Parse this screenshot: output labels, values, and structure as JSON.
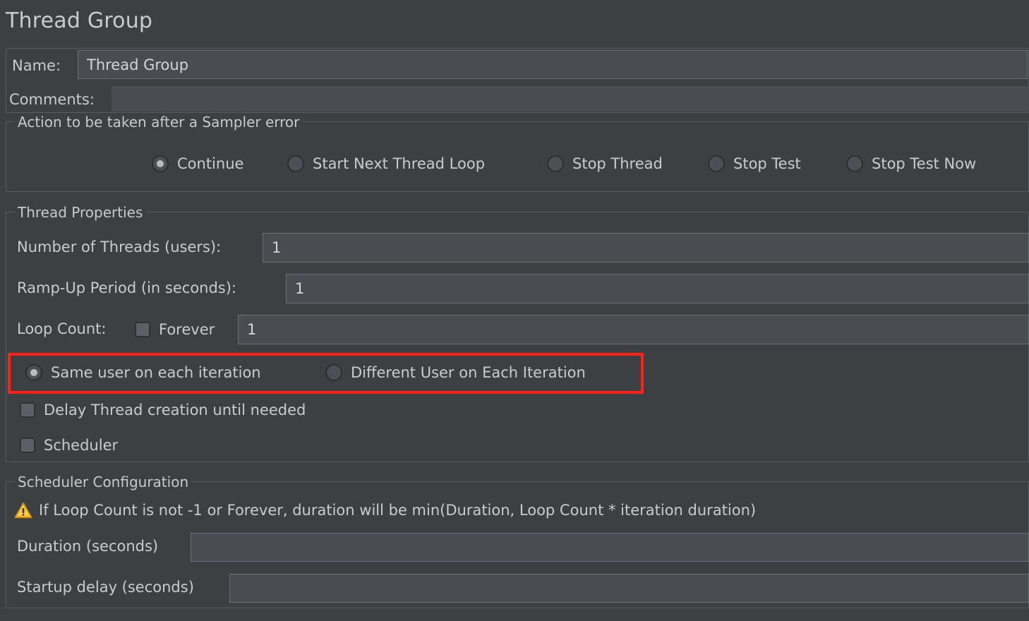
{
  "window": {
    "title": "Thread Group"
  },
  "name_row": {
    "label": "Name:",
    "value": "Thread Group"
  },
  "comments_row": {
    "label": "Comments:",
    "value": ""
  },
  "sampler_error": {
    "legend": "Action to be taken after a Sampler error",
    "options": [
      {
        "label": "Continue",
        "selected": true
      },
      {
        "label": "Start Next Thread Loop",
        "selected": false
      },
      {
        "label": "Stop Thread",
        "selected": false
      },
      {
        "label": "Stop Test",
        "selected": false
      },
      {
        "label": "Stop Test Now",
        "selected": false
      }
    ]
  },
  "thread_properties": {
    "legend": "Thread Properties",
    "num_threads": {
      "label": "Number of Threads (users):",
      "value": "1"
    },
    "ramp_up": {
      "label": "Ramp-Up Period (in seconds):",
      "value": "1"
    },
    "loop_count": {
      "label": "Loop Count:",
      "forever_label": "Forever",
      "forever_checked": false,
      "value": "1"
    },
    "iteration_mode": {
      "highlighted": true,
      "options": [
        {
          "label": "Same user on each iteration",
          "selected": true
        },
        {
          "label": "Different User on Each Iteration",
          "selected": false
        }
      ]
    },
    "delay_thread_creation": {
      "label": "Delay Thread creation until needed",
      "checked": false
    },
    "scheduler": {
      "label": "Scheduler",
      "checked": false
    }
  },
  "scheduler_configuration": {
    "legend": "Scheduler Configuration",
    "warning": {
      "icon": "warning-triangle-icon",
      "text": "If Loop Count is not -1 or Forever, duration will be min(Duration, Loop Count * iteration duration)"
    },
    "duration": {
      "label": "Duration (seconds)",
      "value": ""
    },
    "startup_delay": {
      "label": "Startup delay (seconds)",
      "value": ""
    }
  },
  "colors": {
    "background": "#3c4043",
    "field_background": "#494d51",
    "text": "#c9ccce",
    "border": "#6a6f73",
    "highlight": "#ff2117",
    "warning": "#f0a41e"
  }
}
